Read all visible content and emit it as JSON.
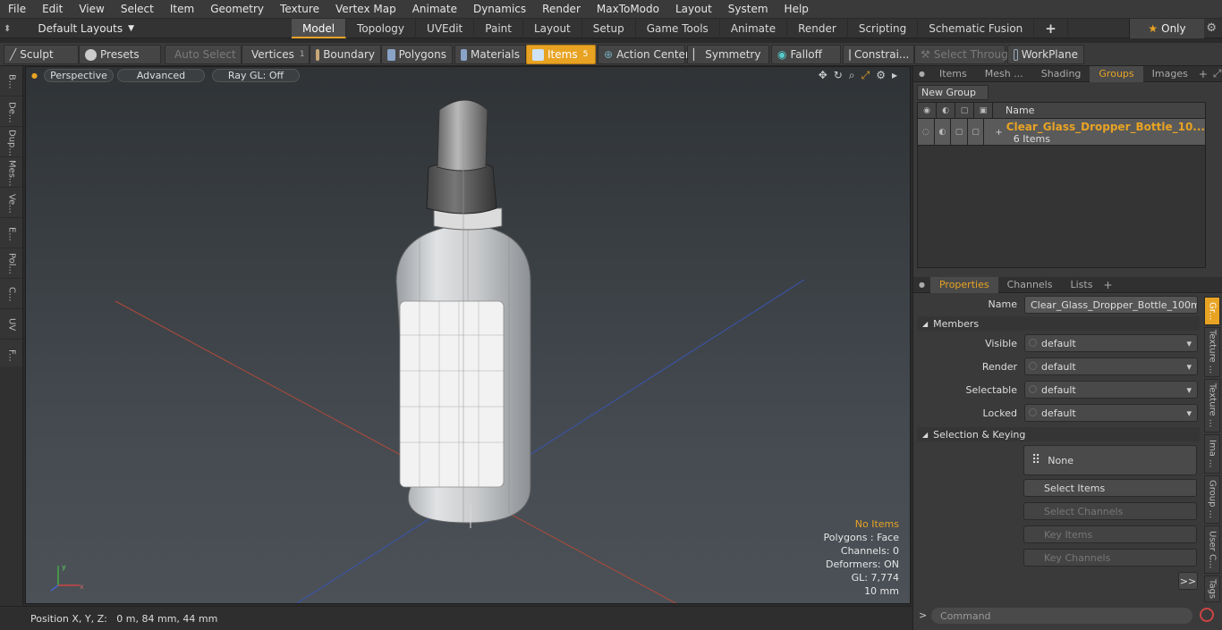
{
  "menu": [
    "File",
    "Edit",
    "View",
    "Select",
    "Item",
    "Geometry",
    "Texture",
    "Vertex Map",
    "Animate",
    "Dynamics",
    "Render",
    "MaxToModo",
    "Layout",
    "System",
    "Help"
  ],
  "layout": {
    "default_layouts": "Default Layouts",
    "tabs": [
      "Model",
      "Topology",
      "UVEdit",
      "Paint",
      "Layout",
      "Setup",
      "Game Tools",
      "Animate",
      "Render",
      "Scripting",
      "Schematic Fusion"
    ],
    "active_tab": "Model",
    "only_label": "Only"
  },
  "toolbar": {
    "sculpt": "Sculpt",
    "presets": "Presets",
    "auto_select": "Auto Select",
    "vertices": "Vertices",
    "vertices_count": "1",
    "boundary": "Boundary",
    "polygons": "Polygons",
    "materials": "Materials",
    "items": "Items",
    "items_count": "5",
    "action_center": "Action Center",
    "symmetry": "Symmetry",
    "falloff": "Falloff",
    "constraints": "Constrai...",
    "select_through": "Select Through",
    "workplane": "WorkPlane"
  },
  "left_tabs": [
    "B...",
    "De...",
    "Dup...",
    "Mes...",
    "Ve...",
    "E...",
    "Pol...",
    "C...",
    "UV",
    "F..."
  ],
  "viewport": {
    "perspective": "Perspective",
    "advanced": "Advanced",
    "raygl": "Ray GL: Off",
    "stats": {
      "items": "No Items",
      "polygons": "Polygons : Face",
      "channels": "Channels: 0",
      "deformers": "Deformers: ON",
      "gl": "GL: 7,774",
      "scale": "10 mm"
    }
  },
  "status": {
    "position": "Position X, Y, Z:   0 m, 84 mm, 44 mm"
  },
  "groups_panel": {
    "tabs": [
      "Items",
      "Mesh ...",
      "Shading",
      "Groups",
      "Images"
    ],
    "active_tab": "Groups",
    "new_group": "New Group",
    "name_header": "Name",
    "group_name": "Clear_Glass_Dropper_Bottle_10...",
    "group_sub": "6 Items"
  },
  "properties": {
    "tabs": [
      "Properties",
      "Channels",
      "Lists"
    ],
    "active_tab": "Properties",
    "name_label": "Name",
    "name_value": "Clear_Glass_Dropper_Bottle_100ml (8",
    "members_title": "Members",
    "visible_label": "Visible",
    "visible_value": "default",
    "render_label": "Render",
    "render_value": "default",
    "selectable_label": "Selectable",
    "selectable_value": "default",
    "locked_label": "Locked",
    "locked_value": "default",
    "selection_title": "Selection & Keying",
    "none_label": "None",
    "select_items": "Select Items",
    "select_channels": "Select Channels",
    "key_items": "Key Items",
    "key_channels": "Key Channels",
    "more": ">>",
    "side_tabs": [
      "Gr...",
      "Texture ...",
      "Texture ...",
      "Ima ...",
      "Group ...",
      "User C...",
      "Tags"
    ]
  },
  "command": {
    "placeholder": "Command",
    "prompt": ">"
  },
  "colors": {
    "accent": "#e8a323",
    "panel": "#3a3a3a"
  }
}
